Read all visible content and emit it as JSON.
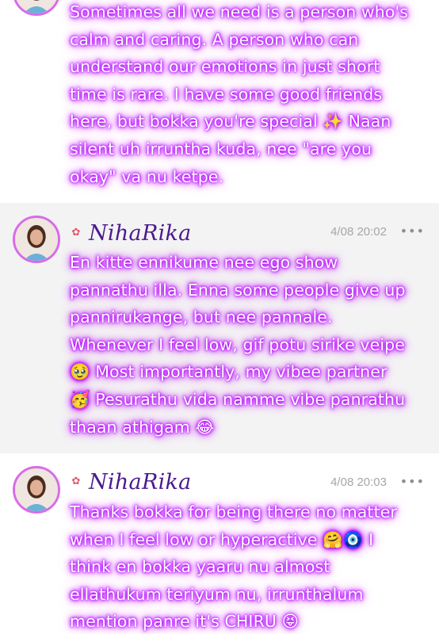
{
  "posts": [
    {
      "message_lines": [
        "Sometimes all we need is a person who's",
        "calm and caring. A person who can",
        "understand our emotions in just short",
        "time is rare. I have some good friends",
        "here, but bokka you're special ✨ Naan",
        "silent uh irruntha kuda, nee \"are you",
        "okay\" va nu ketpe."
      ]
    },
    {
      "user": "NihaRika",
      "time": "4/08 20:02",
      "more": "•••",
      "message_lines": [
        "En kitte ennikume nee ego show",
        "pannathu illa. Enna some people give up",
        "pannirukange, but nee pannale.",
        "Whenever I feel low, gif potu sirike veipe",
        "🥹 Most importantly, my vibee partner",
        "🥳 Pesurathu vida namme vibe panrathu",
        "thaan athigam 😂"
      ]
    },
    {
      "user": "NihaRika",
      "time": "4/08 20:03",
      "more": "•••",
      "message_lines": [
        "Thanks bokka for being there no matter",
        "when I feel low or hyperactive 🤗🧿 I",
        "think en bokka yaaru nu almost",
        "ellathukum teriyum nu, irrunthalum",
        "mention panre it's CHIRU 😝"
      ]
    }
  ],
  "colors": {
    "glow": "#b000ff",
    "name": "#4b1a8c",
    "avatar_ring": "#d96be8",
    "alt_bg": "#f3f3f4"
  },
  "icons": [
    "flower-icon",
    "more-icon"
  ]
}
